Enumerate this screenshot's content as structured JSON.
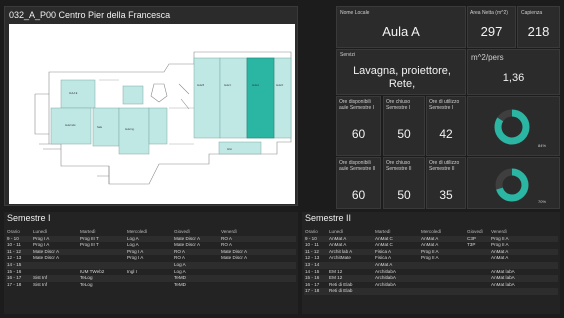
{
  "map": {
    "title": "032_A_P00 Centro Pier della Francesca",
    "accent_color": "#2bb5a3",
    "room_color": "#bfe8e4"
  },
  "room": {
    "name_label": "Nome Locale",
    "name": "Aula A",
    "area_label": "Area Netta (m^2)",
    "area": "297",
    "capacity_label": "Capienza",
    "capacity": "218",
    "services_label": "Servizi",
    "services": "Lavagna, proiettore, Rete,",
    "ratio_label": "m^2/pers",
    "ratio": "1,36"
  },
  "sem1_stats": {
    "available_label": "Ore disponibili aule Semestre I",
    "available": "60",
    "closed_label": "Ore chiuso Semestre I",
    "closed": "50",
    "used_label": "Ore di utilizzo Semestre I",
    "used": "42",
    "percent_label": "84%",
    "percent": 84
  },
  "sem2_stats": {
    "available_label": "Ore disponibili aule Semestre II",
    "available": "60",
    "closed_label": "Ore chiuso Semestre II",
    "closed": "50",
    "used_label": "Ore di utilizzo Semestre II",
    "used": "35",
    "percent_label": "70%",
    "percent": 70
  },
  "semestre1": {
    "title": "Semestre I",
    "headers": [
      "Orario",
      "Lunedì",
      "Martedì",
      "Mercoledì",
      "Giovedì",
      "Venerdì"
    ],
    "rows": [
      [
        "9 - 10",
        "Prog I A",
        "Prog III T",
        "Log A",
        "Mate Discr A",
        "RO A"
      ],
      [
        "10 - 11",
        "Prog I A",
        "Prog III T",
        "Log A",
        "Mate Discr A",
        "RO A"
      ],
      [
        "11 - 12",
        "Mate Discr A",
        "",
        "Prog I A",
        "RO A",
        "Mate Discr A"
      ],
      [
        "12 - 13",
        "Mate Discr A",
        "",
        "Prog I A",
        "RO A",
        "Mate Discr A"
      ],
      [
        "14 - 15",
        "",
        "",
        "",
        "Log A",
        ""
      ],
      [
        "15 - 16",
        "",
        "IUM TWeb2",
        "Ingl I",
        "Log A",
        ""
      ],
      [
        "16 - 17",
        "Sist Inf",
        "TeLog",
        "",
        "TeMD",
        ""
      ],
      [
        "17 - 18",
        "Sist Inf",
        "TeLog",
        "",
        "TeMD",
        ""
      ]
    ]
  },
  "semestre2": {
    "title": "Semestre II",
    "headers": [
      "Orario",
      "Lunedì",
      "Martedì",
      "Mercoledì",
      "Giovedì",
      "Venerdì"
    ],
    "rows": [
      [
        "9 - 10",
        "AnMat A",
        "AnMat C",
        "AnMat A",
        "C3P",
        "Prog II A"
      ],
      [
        "10 - 11",
        "AnMat A",
        "AnMat C",
        "AnMat A",
        "T3P",
        "Prog II A"
      ],
      [
        "11 - 12",
        "Archit lab A",
        "Fisica A",
        "Prog II A",
        "",
        "AnMat A"
      ],
      [
        "12 - 13",
        "ArchitMate",
        "Fisica A",
        "Prog II A",
        "",
        "AnMat A"
      ],
      [
        "13 - 14",
        "",
        "AnMat A",
        "",
        "",
        ""
      ],
      [
        "14 - 15",
        "EM 12",
        "ArchitlabA",
        "",
        "",
        "AnMat labA"
      ],
      [
        "15 - 16",
        "EM 12",
        "ArchitlabA",
        "",
        "",
        "AnMat labA"
      ],
      [
        "16 - 17",
        "Reti di Elab",
        "ArchitlabA",
        "",
        "",
        "AnMat labA"
      ],
      [
        "17 - 18",
        "Reti di Elab",
        "",
        "",
        "",
        ""
      ]
    ]
  }
}
